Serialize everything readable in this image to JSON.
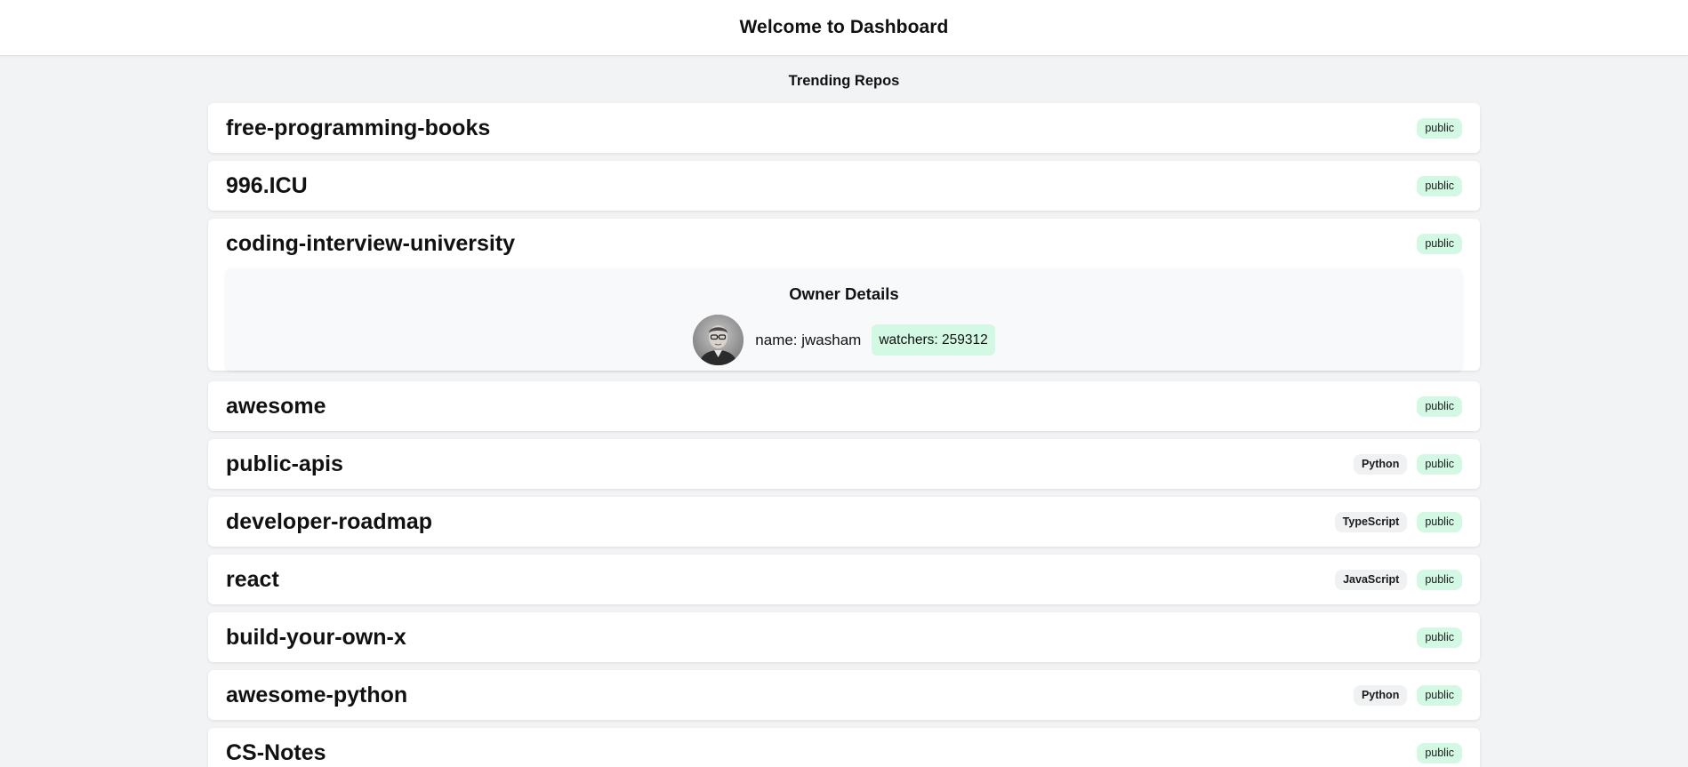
{
  "header": {
    "title": "Welcome to Dashboard"
  },
  "section": {
    "title": "Trending Repos"
  },
  "repos": [
    {
      "name": "free-programming-books",
      "language": "",
      "visibility": "public"
    },
    {
      "name": "996.ICU",
      "language": "",
      "visibility": "public"
    },
    {
      "name": "coding-interview-university",
      "language": "",
      "visibility": "public"
    },
    {
      "name": "awesome",
      "language": "",
      "visibility": "public"
    },
    {
      "name": "public-apis",
      "language": "Python",
      "visibility": "public"
    },
    {
      "name": "developer-roadmap",
      "language": "TypeScript",
      "visibility": "public"
    },
    {
      "name": "react",
      "language": "JavaScript",
      "visibility": "public"
    },
    {
      "name": "build-your-own-x",
      "language": "",
      "visibility": "public"
    },
    {
      "name": "awesome-python",
      "language": "Python",
      "visibility": "public"
    },
    {
      "name": "CS-Notes",
      "language": "",
      "visibility": "public"
    }
  ],
  "owner_details": {
    "title": "Owner Details",
    "name_text": "name: jwasham",
    "watchers_text": "watchers: 259312"
  },
  "colors": {
    "public_badge": "#d3f9e4",
    "language_badge": "#f0f1f3",
    "page_background": "#f2f3f5"
  }
}
